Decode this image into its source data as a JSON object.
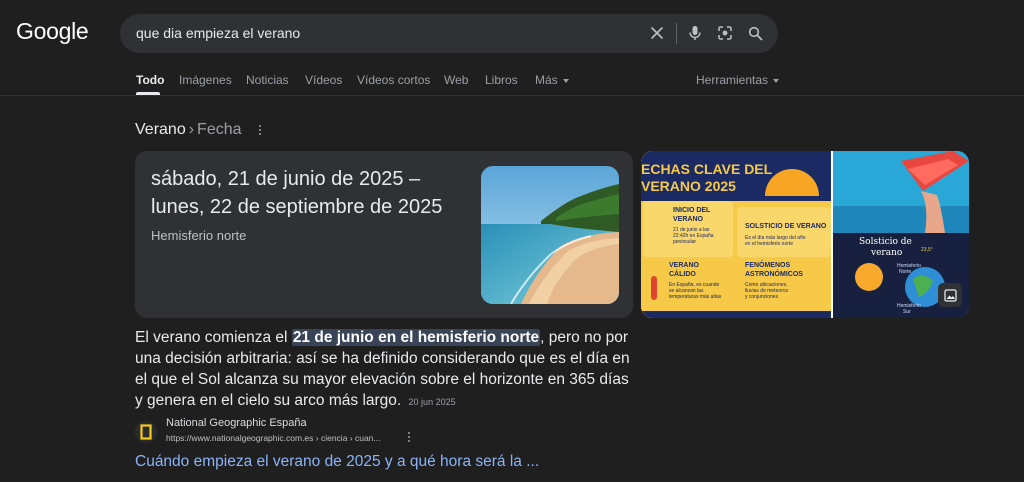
{
  "header": {
    "logo": "Google",
    "search_value": "que dia empieza el verano"
  },
  "tabs": [
    {
      "label": "Todo",
      "active": true
    },
    {
      "label": "Imágenes"
    },
    {
      "label": "Noticias"
    },
    {
      "label": "Vídeos"
    },
    {
      "label": "Vídeos cortos"
    },
    {
      "label": "Web"
    },
    {
      "label": "Libros"
    },
    {
      "label": "Más"
    }
  ],
  "tools_label": "Herramientas",
  "breadcrumb": {
    "first": "Verano",
    "sep": "›",
    "second": "Fecha"
  },
  "answer": {
    "line1": "sábado, 21 de junio de 2025 –",
    "line2": "lunes, 22 de septiembre de 2025",
    "hemisphere": "Hemisferio norte"
  },
  "infographic": {
    "title1": "ECHAS CLAVE DEL",
    "title2": "VERANO 2025",
    "b1_title1": "INICIO DEL",
    "b1_title2": "VERANO",
    "b1_text1": "21 de junio a las",
    "b1_text2": "22:42h en España",
    "b1_text3": "peninsular",
    "b2_title": "SOLSTICIO DE VERANO",
    "b2_text1": "Es el día más largo del año",
    "b2_text2": "en el hemisferio norte",
    "b3_title1": "VERANO",
    "b3_title2": "CÁLIDO",
    "b3_text1": "En España, es cuando",
    "b3_text2": "se alcanzan las",
    "b3_text3": "temperaturas más altas",
    "b4_title1": "FENÓMENOS",
    "b4_title2": "ASTRONÓMICOS",
    "b4_text1": "Como ubicaciones,",
    "b4_text2": "lluvias de meteoros",
    "b4_text3": "y conjunciones",
    "s_title1": "Solsticio de",
    "s_title2": "verano",
    "s_label1": "Hemisferio",
    "s_label2": "Norte",
    "s_label3": "Hemisferio",
    "s_label4": "Sur",
    "s_deg": "23,5°"
  },
  "snippet": {
    "pre": "El verano comienza el ",
    "highlight": "21 de junio en el hemisferio norte",
    "post": ", pero no por una decisión arbitraria: así se ha definido considerando que es el día en el que el Sol alcanza su mayor elevación sobre el horizonte en 365 días y genera en el cielo su arco más largo.",
    "date": "20 jun 2025"
  },
  "source": {
    "name": "National Geographic España",
    "url": "https://www.nationalgeographic.com.es › ciencia › cuan...",
    "link_title": "Cuándo empieza el verano de 2025 y a qué hora será la ..."
  },
  "colors": {
    "background": "#1f1f1f",
    "card": "#303134",
    "link": "#8ab4f8",
    "highlight": "#394457",
    "infographic_yellow": "#f7c948",
    "infographic_navy": "#17213f"
  }
}
